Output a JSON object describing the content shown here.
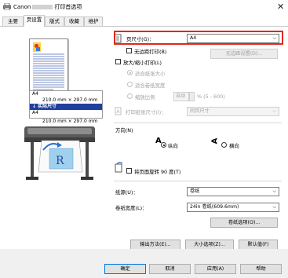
{
  "window": {
    "brand": "Canon",
    "title": "打印首选项",
    "close_glyph": "✕"
  },
  "tabs": [
    {
      "label": "主要"
    },
    {
      "label": "页设置"
    },
    {
      "label": "版式"
    },
    {
      "label": "收藏"
    },
    {
      "label": "维护"
    }
  ],
  "preview": {
    "paper_size_top": "A4",
    "paper_size_top_dims": "210.0 mm × 297.0 mm",
    "arrow_label": "实际尺寸",
    "paper_size_bottom": "A4",
    "paper_size_bottom_dims": "210.0 mm × 297.0 mm"
  },
  "page_setup": {
    "page_size_label": "页尺寸(G)：",
    "page_size_value": "A4",
    "borderless_label": "无边距打印(B)",
    "borderless_button": "无边距设置(D)...",
    "enlarge_reduce_label": "放大/缩小打印(L)",
    "fit_page_label": "适合纸张大小",
    "fit_roll_label": "适合卷纸宽度",
    "scaling_label": "缩放比例",
    "scaling_value": "自动",
    "scaling_range": "% (5 - 600)",
    "output_paper_label": "打印纸张尺寸(I)：",
    "output_paper_value": "同页尺寸"
  },
  "orientation": {
    "label": "方向(N)",
    "portrait": "纵向",
    "landscape": "横向",
    "rotate_label": "将页面旋转 90 度(T)"
  },
  "paper": {
    "source_label": "纸源(U)：",
    "source_value": "卷纸",
    "roll_width_label": "卷纸宽度(L)：",
    "roll_width_value": "24in 卷纸(609.6mm)",
    "roll_options_button": "卷纸选项(O)..."
  },
  "bottom_buttons": {
    "output_method": "输出方法(E)...",
    "size_options": "大小选项(Z)...",
    "defaults": "默认值(F)"
  },
  "footer": {
    "ok": "确定",
    "cancel": "取消",
    "apply": "应用(A)",
    "help": "帮助"
  },
  "colors": {
    "highlight_border": "#e0281d",
    "selection_bg": "#1f3f9f"
  }
}
